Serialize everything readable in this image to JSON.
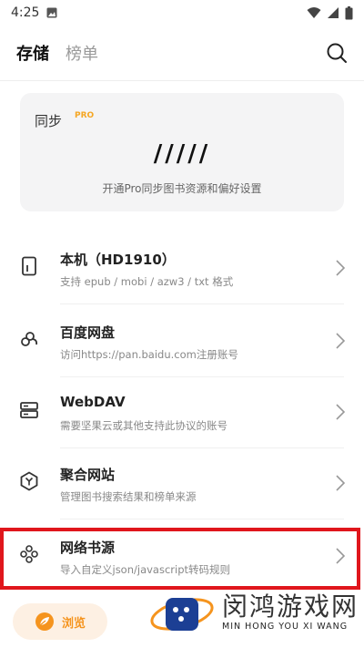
{
  "status_bar": {
    "time": "4:25"
  },
  "header": {
    "tabs": [
      {
        "label": "存储"
      },
      {
        "label": "榜单"
      }
    ]
  },
  "sync_card": {
    "title": "同步",
    "badge": "PRO",
    "slashes": "/////",
    "description": "开通Pro同步图书资源和偏好设置"
  },
  "storage_items": [
    {
      "title": "本机（HD1910）",
      "subtitle": "支持 epub / mobi / azw3 / txt 格式",
      "icon": "phone-icon"
    },
    {
      "title": "百度网盘",
      "subtitle": "访问https://pan.baidu.com注册账号",
      "icon": "cloud-drive-icon"
    },
    {
      "title": "WebDAV",
      "subtitle": "需要坚果云或其他支持此协议的账号",
      "icon": "server-icon"
    },
    {
      "title": "聚合网站",
      "subtitle": "管理图书搜索结果和榜单来源",
      "icon": "hexagon-y-icon"
    },
    {
      "title": "网络书源",
      "subtitle": "导入自定义json/javascript转码规则",
      "icon": "network-icon"
    }
  ],
  "browse_button": {
    "label": "浏览"
  },
  "watermark": {
    "title": "闵鸿游戏网",
    "subtitle": "MIN HONG YOU XI WANG"
  },
  "colors": {
    "accent_orange": "#f5941e",
    "highlight_red": "#e0161c",
    "card_bg": "#f4f4f5"
  }
}
